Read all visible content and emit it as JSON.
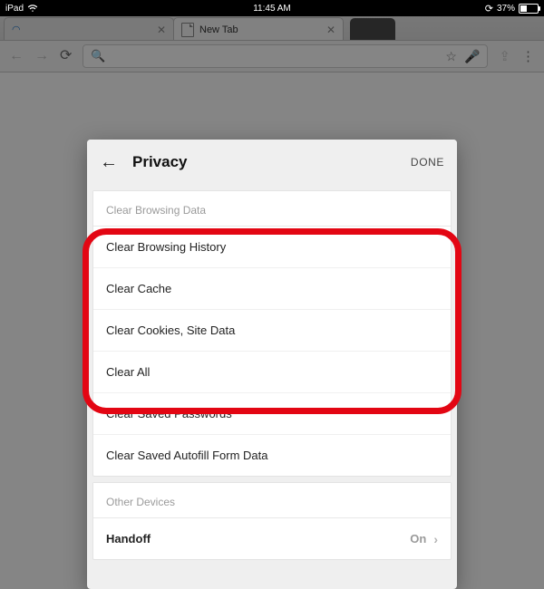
{
  "statusbar": {
    "device": "iPad",
    "time": "11:45 AM",
    "battery_text": "37%",
    "battery_level_pct": 37,
    "rotation_lock_icon": "rotation-lock-icon",
    "wifi_icon": "wifi-icon",
    "battery_icon": "battery-icon"
  },
  "browser": {
    "tabs": [
      {
        "title": "",
        "is_active": false
      },
      {
        "title": "New Tab",
        "is_active": true
      }
    ],
    "toolbar": {
      "back_icon": "back-icon",
      "forward_icon": "forward-icon",
      "reload_icon": "reload-icon",
      "search_icon": "search-icon",
      "star_icon": "star-icon",
      "mic_icon": "mic-icon",
      "share_icon": "share-icon",
      "more_icon": "more-icon",
      "omnibox_value": ""
    }
  },
  "modal": {
    "back_icon": "back-icon",
    "title": "Privacy",
    "done_label": "DONE",
    "sections": [
      {
        "header": "Clear Browsing Data",
        "rows": [
          {
            "label": "Clear Browsing History"
          },
          {
            "label": "Clear Cache"
          },
          {
            "label": "Clear Cookies, Site Data"
          },
          {
            "label": "Clear All"
          },
          {
            "label": "Clear Saved Passwords"
          },
          {
            "label": "Clear Saved Autofill Form Data"
          }
        ]
      },
      {
        "header": "Other Devices",
        "rows": [
          {
            "label": "Handoff",
            "value": "On",
            "chevron": true,
            "bold": true
          }
        ]
      }
    ]
  },
  "annotation": {
    "description": "red-rounded-rectangle-highlight",
    "highlights_rows": [
      "Clear Browsing History",
      "Clear Cache",
      "Clear Cookies, Site Data",
      "Clear All"
    ],
    "color": "#e30613"
  }
}
